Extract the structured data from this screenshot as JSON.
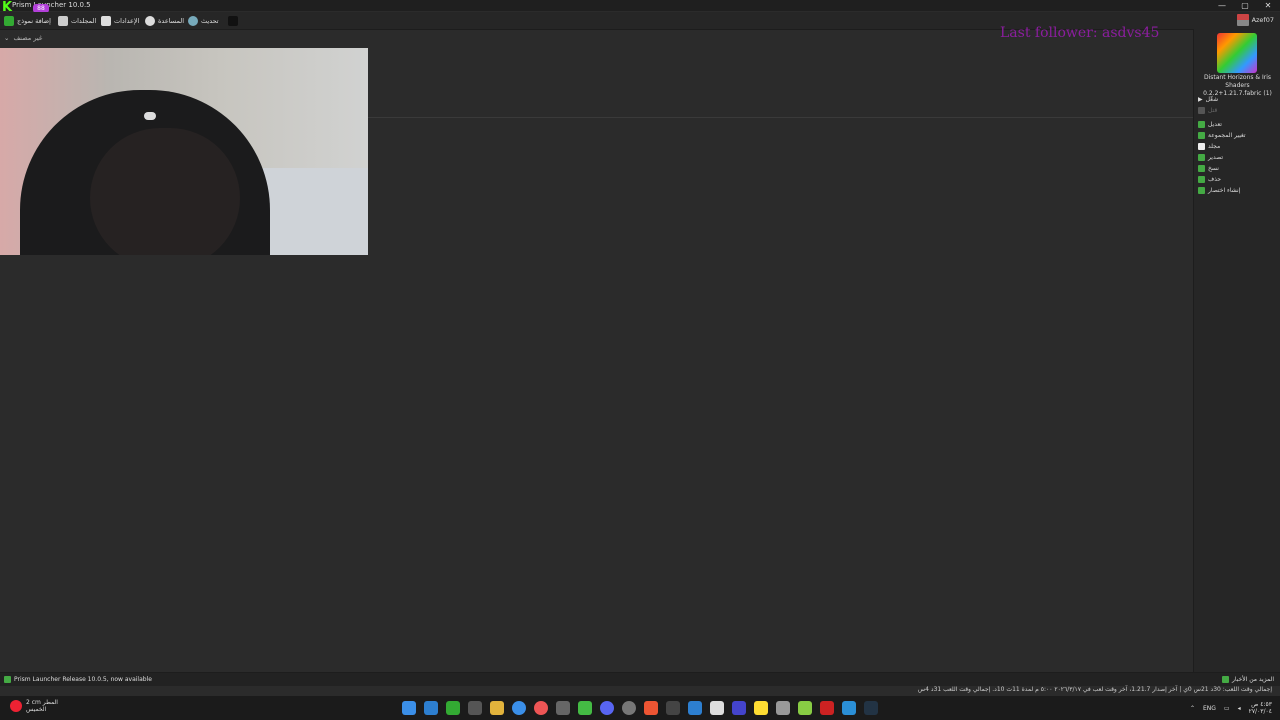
{
  "window": {
    "title": "Prism Launcher 10.0.5",
    "controls": [
      "—",
      "▢",
      "✕"
    ]
  },
  "overlay": {
    "kick_logo": "K",
    "kick_badge": "88",
    "last_follower": "Last follower: asdvs45"
  },
  "toolbar": {
    "add_instance": "إضافة نموذج",
    "folders": "المجلدات",
    "settings": "الإعدادات",
    "help": "المساعدة",
    "update": "تحديث",
    "username": "Azef07"
  },
  "main": {
    "group_label": "غير مصنف"
  },
  "sidebar": {
    "instance_name": "Distant Horizons & Iris Shaders 0.2.2+1.21.7.fabric (1)",
    "items": [
      {
        "label": "شغّل",
        "enabled": true,
        "icon": "play-icon"
      },
      {
        "label": "قتل",
        "enabled": false,
        "icon": "kill-icon"
      },
      {
        "label": "تعديل",
        "enabled": true,
        "icon": "edit-icon"
      },
      {
        "label": "تغيير المجموعة",
        "enabled": true,
        "icon": "group-icon"
      },
      {
        "label": "مجلد",
        "enabled": true,
        "icon": "folder-icon"
      },
      {
        "label": "تصدير",
        "enabled": true,
        "icon": "export-icon"
      },
      {
        "label": "نسخ",
        "enabled": true,
        "icon": "copy-icon"
      },
      {
        "label": "حذف",
        "enabled": true,
        "icon": "delete-icon"
      },
      {
        "label": "إنشاء اختصار",
        "enabled": true,
        "icon": "shortcut-icon"
      }
    ]
  },
  "status": {
    "update_notice": "Prism Launcher Release 10.0.5, now available",
    "news": "المزيد من الأخبار",
    "playtime": "إجمالي وقت اللعب: 30د 21س 0ي | آخر إصدار 1.21.7، آخر وقت لعب في ٢٠٢٦/٣/١٧ ٥:٠٠ م لمدة 11ث 10د. إجمالي وقت اللعب 31د 4س"
  },
  "taskbar": {
    "weather_temp": "2 cm المطر",
    "weather_desc": "الخميس",
    "language": "ENG",
    "time": "٤:٥٣ ص",
    "date": "٢٧/٠٣/٠٤"
  },
  "colors": {
    "background": "#2b2b2b",
    "follower_text": "#8b1e9e",
    "kick_green": "#53fc18"
  }
}
